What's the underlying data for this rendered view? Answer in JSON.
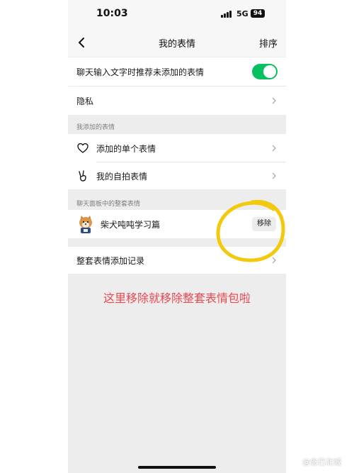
{
  "status_bar": {
    "time": "10:03",
    "network": "5G",
    "battery": "94"
  },
  "nav": {
    "title": "我的表情",
    "sort_label": "排序",
    "back_icon": "chevron-left-icon"
  },
  "settings": {
    "recommend_label": "聊天输入文字时推荐未添加的表情",
    "recommend_enabled": true,
    "privacy_label": "隐私"
  },
  "added_section": {
    "header": "我添加的表情",
    "items": [
      {
        "label": "添加的单个表情",
        "icon": "heart-icon"
      },
      {
        "label": "我的自拍表情",
        "icon": "peace-hand-icon"
      }
    ]
  },
  "panel_section": {
    "header": "聊天面板中的整套表情",
    "packs": [
      {
        "name": "柴犬吨吨学习篇",
        "action_label": "移除",
        "icon": "shiba-dog-icon"
      }
    ]
  },
  "history_label": "整套表情添加记录",
  "annotation_text": "这里移除就移除整套表情包啦",
  "colors": {
    "toggle_on": "#07c160",
    "annotation_red": "#e8484f",
    "annotation_circle": "#f2c90e"
  },
  "watermark": "@念已北城"
}
